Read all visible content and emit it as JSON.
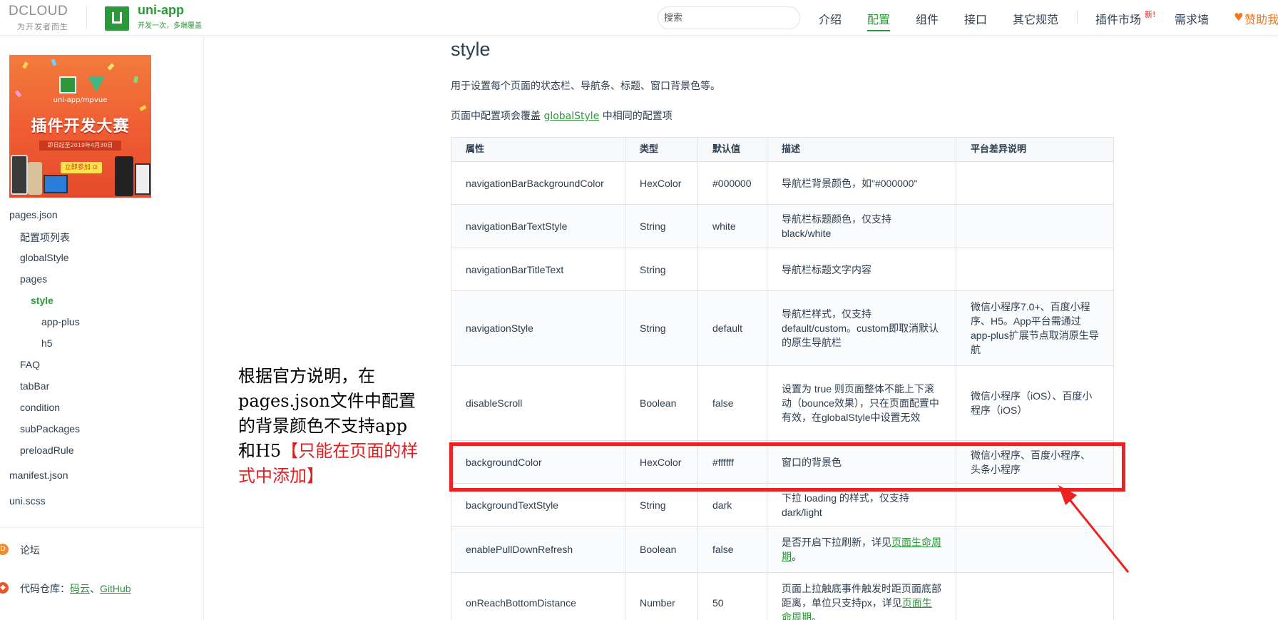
{
  "header": {
    "dcloud_logo": "DCLOUD",
    "dcloud_slogan": "为开发者而生",
    "uni_title": "uni-app",
    "uni_subtitle": "开发一次，多端覆盖",
    "search_placeholder": "搜索",
    "nav": [
      {
        "label": "介绍",
        "active": false
      },
      {
        "label": "配置",
        "active": true
      },
      {
        "label": "组件",
        "active": false
      },
      {
        "label": "接口",
        "active": false
      },
      {
        "label": "其它规范",
        "active": false
      },
      {
        "label": "插件市场",
        "active": false
      },
      {
        "label": "需求墙",
        "active": false
      }
    ],
    "new_badge": "新!",
    "sponsor": "赞助我"
  },
  "sidebar": {
    "banner": {
      "caption": "uni-app/mpvue",
      "title": "插件开发大赛",
      "date": "即日起至2019年4月30日",
      "button": "立即参加 ⊙"
    },
    "items": [
      {
        "label": "pages.json",
        "level": 0,
        "active": false
      },
      {
        "label": "配置项列表",
        "level": 1,
        "active": false
      },
      {
        "label": "globalStyle",
        "level": 1,
        "active": false
      },
      {
        "label": "pages",
        "level": 1,
        "active": false
      },
      {
        "label": "style",
        "level": 2,
        "active": true
      },
      {
        "label": "app-plus",
        "level": 3,
        "active": false
      },
      {
        "label": "h5",
        "level": 3,
        "active": false
      },
      {
        "label": "FAQ",
        "level": 1,
        "active": false
      },
      {
        "label": "tabBar",
        "level": 1,
        "active": false
      },
      {
        "label": "condition",
        "level": 1,
        "active": false
      },
      {
        "label": "subPackages",
        "level": 1,
        "active": false
      },
      {
        "label": "preloadRule",
        "level": 1,
        "active": false
      },
      {
        "label": "manifest.json",
        "level": 0,
        "active": false
      },
      {
        "label": "uni.scss",
        "level": 0,
        "active": false
      }
    ],
    "forum_label": "论坛",
    "repo_label": "代码仓库：",
    "repo_links": [
      "码云",
      "GitHub"
    ],
    "repo_sep": "、"
  },
  "main": {
    "title": "style",
    "para1": "用于设置每个页面的状态栏、导航条、标题、窗口背景色等。",
    "para2_prefix": "页面中配置项会覆盖 ",
    "para2_link": "globalStyle",
    "para2_suffix": " 中相同的配置项",
    "table": {
      "headers": [
        "属性",
        "类型",
        "默认值",
        "描述",
        "平台差异说明"
      ],
      "rows": [
        [
          "navigationBarBackgroundColor",
          "HexColor",
          "#000000",
          "导航栏背景颜色，如\"#000000\"",
          ""
        ],
        [
          "navigationBarTextStyle",
          "String",
          "white",
          "导航栏标题颜色，仅支持 black/white",
          ""
        ],
        [
          "navigationBarTitleText",
          "String",
          "",
          "导航栏标题文字内容",
          ""
        ],
        [
          "navigationStyle",
          "String",
          "default",
          "导航栏样式，仅支持 default/custom。custom即取消默认的原生导航栏",
          "微信小程序7.0+、百度小程序、H5。App平台需通过app-plus扩展节点取消原生导航"
        ],
        [
          "disableScroll",
          "Boolean",
          "false",
          "设置为 true 则页面整体不能上下滚动（bounce效果），只在页面配置中有效，在globalStyle中设置无效",
          "微信小程序（iOS）、百度小程序（iOS）"
        ],
        [
          "backgroundColor",
          "HexColor",
          "#ffffff",
          "窗口的背景色",
          "微信小程序、百度小程序、头条小程序"
        ],
        [
          "backgroundTextStyle",
          "String",
          "dark",
          "下拉 loading 的样式，仅支持 dark/light",
          ""
        ],
        [
          "enablePullDownRefresh",
          "Boolean",
          "false",
          "是否开启下拉刷新，详见",
          ""
        ],
        [
          "onReachBottomDistance",
          "Number",
          "50",
          "页面上拉触底事件触发时距页面底部距离，单位只支持px，详见",
          ""
        ]
      ],
      "link_text": "页面生命周期",
      "link_suffix": "。"
    },
    "annotation": {
      "black": "根据官方说明，在pages.json文件中配置的背景颜色不支持app和H5",
      "red": "【只能在页面的样式中添加】"
    }
  },
  "colors": {
    "brand_green": "#2b9939",
    "highlight_red": "#ec2121",
    "sponsor_orange": "#f3761a"
  }
}
